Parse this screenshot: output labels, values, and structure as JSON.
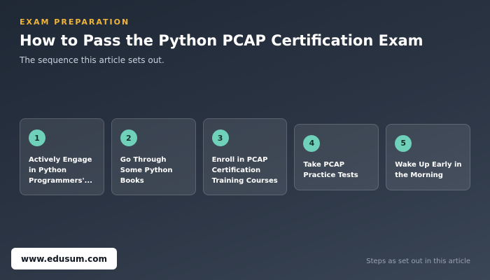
{
  "header": {
    "eyebrow": "EXAM PREPARATION",
    "title": "How to Pass the Python PCAP Certification Exam",
    "subtitle": "The sequence this article sets out."
  },
  "steps": [
    {
      "number": "1",
      "label": "Actively Engage in Python Programmers'..."
    },
    {
      "number": "2",
      "label": "Go Through Some Python Books"
    },
    {
      "number": "3",
      "label": "Enroll in PCAP Certification Training Courses"
    },
    {
      "number": "4",
      "label": "Take PCAP Practice Tests"
    },
    {
      "number": "5",
      "label": "Wake Up Early in the Morning"
    }
  ],
  "footer": {
    "url": "www.edusum.com",
    "note": "Steps as set out in this article"
  },
  "colors": {
    "accent": "#f0b43a",
    "step_badge": "#6fd1ba",
    "background": "#263040"
  }
}
